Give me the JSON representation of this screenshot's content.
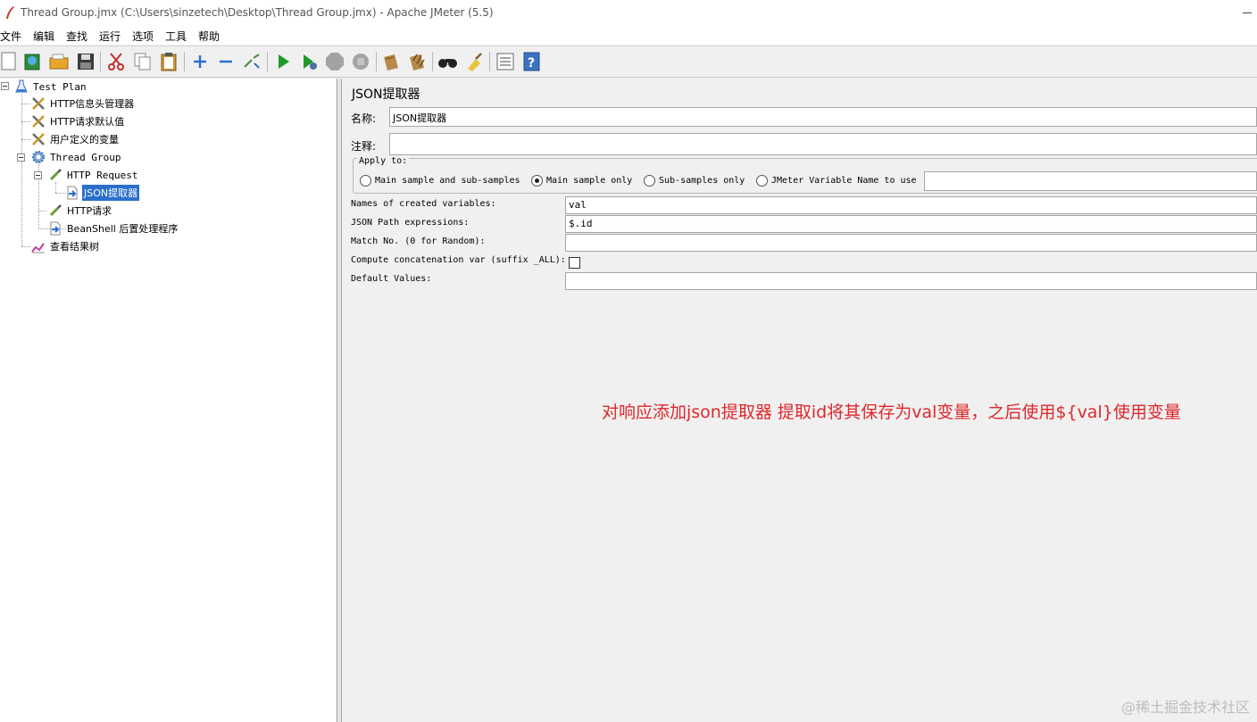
{
  "window": {
    "title": "Thread Group.jmx (C:\\Users\\sinzetech\\Desktop\\Thread Group.jmx) - Apache JMeter (5.5)"
  },
  "menu": [
    "文件",
    "编辑",
    "查找",
    "运行",
    "选项",
    "工具",
    "帮助"
  ],
  "toolbar": {
    "buttons": [
      "new-icon",
      "templates-icon",
      "open-icon",
      "save-icon",
      "cut-icon",
      "copy-icon",
      "paste-icon",
      "expand-icon",
      "collapse-icon",
      "toggle-icon",
      "start-icon",
      "start-no-pauses-icon",
      "stop-icon",
      "shutdown-icon",
      "clear-icon",
      "clear-all-icon",
      "search-icon",
      "reset-search-icon",
      "function-helper-icon",
      "help-icon"
    ]
  },
  "tree": {
    "items": [
      {
        "label": "Test Plan",
        "icon": "flask-icon"
      },
      {
        "label": "HTTP信息头管理器",
        "icon": "wrench-icon"
      },
      {
        "label": "HTTP请求默认值",
        "icon": "wrench-icon"
      },
      {
        "label": "用户定义的变量",
        "icon": "wrench-icon"
      },
      {
        "label": "Thread Group",
        "icon": "gear-icon"
      },
      {
        "label": "HTTP Request",
        "icon": "pipette-icon"
      },
      {
        "label": "JSON提取器",
        "icon": "post-processor-icon"
      },
      {
        "label": "HTTP请求",
        "icon": "pipette-icon"
      },
      {
        "label": "BeanShell 后置处理程序",
        "icon": "post-processor-icon"
      },
      {
        "label": "查看结果树",
        "icon": "graph-icon"
      }
    ]
  },
  "panel": {
    "title": "JSON提取器",
    "name_label": "名称:",
    "name_value": "JSON提取器",
    "comment_label": "注释:",
    "comment_value": "",
    "apply_to": {
      "title": "Apply to:",
      "options": [
        "Main sample and sub-samples",
        "Main sample only",
        "Sub-samples only",
        "JMeter Variable Name to use"
      ],
      "selected": "Main sample only",
      "variable_value": ""
    },
    "fields": {
      "names_label": "Names of created variables:",
      "names_value": "val",
      "path_label": "JSON Path expressions:",
      "path_value": "$.id",
      "match_label": "Match No. (0 for Random):",
      "match_value": "",
      "concat_label": "Compute concatenation var (suffix _ALL):",
      "concat_checked": false,
      "default_label": "Default Values:",
      "default_value": ""
    }
  },
  "annotation": "对响应添加json提取器 提取id将其保存为val变量，之后使用${val}使用变量",
  "watermark": "@稀土掘金技术社区"
}
